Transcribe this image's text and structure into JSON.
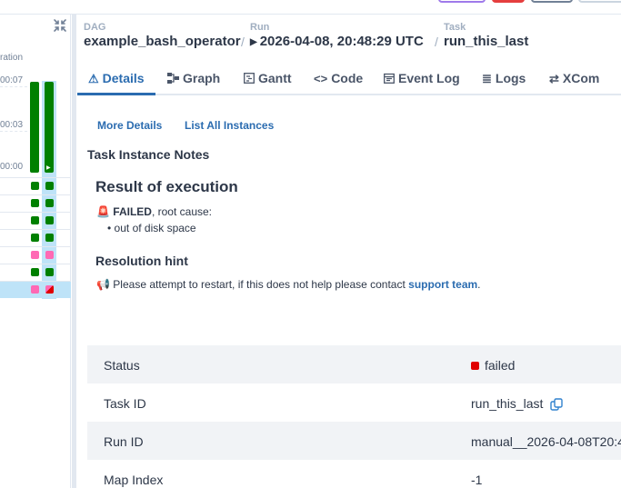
{
  "grid": {
    "duration_label": "ration",
    "ticks": [
      "00:07",
      "00:03",
      "00:00"
    ],
    "rows": [
      {
        "a": "success",
        "b": "success"
      },
      {
        "a": "success",
        "b": "success"
      },
      {
        "a": "success",
        "b": "success"
      },
      {
        "a": "success",
        "b": "success"
      },
      {
        "a": "skipped",
        "b": "skipped"
      },
      {
        "a": "success",
        "b": "success"
      },
      {
        "a": "skipped",
        "b": "failed"
      }
    ]
  },
  "breadcrumb": {
    "dag_label": "DAG",
    "dag_value": "example_bash_operator",
    "run_label": "Run",
    "run_value": "2026-04-08, 20:48:29 UTC",
    "task_label": "Task",
    "task_value": "run_this_last"
  },
  "tabs": [
    {
      "label": "Details",
      "icon": "warning-icon"
    },
    {
      "label": "Graph",
      "icon": "graph-icon"
    },
    {
      "label": "Gantt",
      "icon": "gantt-icon"
    },
    {
      "label": "Code",
      "icon": "code-icon"
    },
    {
      "label": "Event Log",
      "icon": "calendar-icon"
    },
    {
      "label": "Logs",
      "icon": "list-icon"
    },
    {
      "label": "XCom",
      "icon": "exchange-icon"
    }
  ],
  "links": {
    "more_details": "More Details",
    "all_instances": "List All Instances"
  },
  "notes": {
    "title": "Task Instance Notes",
    "result_heading": "Result of execution",
    "failed_strong": "FAILED",
    "failed_rest": ", root cause:",
    "cause": "out of disk space",
    "hint_heading": "Resolution hint",
    "hint_text": "Please attempt to restart, if this does not help please contact ",
    "hint_link": "support team",
    "hint_end": "."
  },
  "table": {
    "rows": [
      {
        "key": "Status",
        "value": "failed"
      },
      {
        "key": "Task ID",
        "value": "run_this_last"
      },
      {
        "key": "Run ID",
        "value": "manual__2026-04-08T20:4"
      },
      {
        "key": "Map Index",
        "value": "-1"
      }
    ]
  },
  "colors": {
    "accent": "#2b6cb0",
    "success": "#008000",
    "failed": "#e00000",
    "skipped": "#ff69b4"
  }
}
